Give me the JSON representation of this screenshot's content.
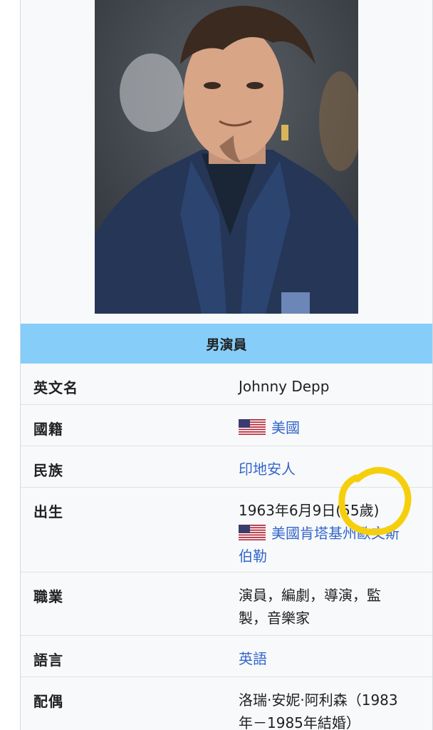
{
  "infobox": {
    "header": "男演員",
    "rows": {
      "english_name": {
        "label": "英文名",
        "value": "Johnny Depp"
      },
      "nationality": {
        "label": "國籍",
        "value": "美國",
        "flag_icon": "us-flag-icon"
      },
      "ethnicity": {
        "label": "民族",
        "value": "印地安人"
      },
      "birth": {
        "label": "出生",
        "date": "1963年6月9日",
        "age": "(55歲)",
        "place_line1": "美國肯塔基州歐文斯",
        "place_line2": "伯勒",
        "flag_icon": "us-flag-icon"
      },
      "occupation": {
        "label": "職業",
        "line1": "演員，編劇，導演，監",
        "line2": "製，音樂家"
      },
      "language": {
        "label": "語言",
        "value": "英語"
      },
      "spouse": {
        "label": "配偶",
        "line1": "洛瑞·安妮·阿利森（1983",
        "line2": "年－1985年結婚）"
      }
    }
  },
  "annotation": {
    "type": "hand-drawn-circle",
    "color": "#f6cf0c"
  },
  "colors": {
    "header_bg": "#87cdfa",
    "link": "#3366cc",
    "text": "#202122",
    "infobox_bg": "#f8f9fa"
  }
}
